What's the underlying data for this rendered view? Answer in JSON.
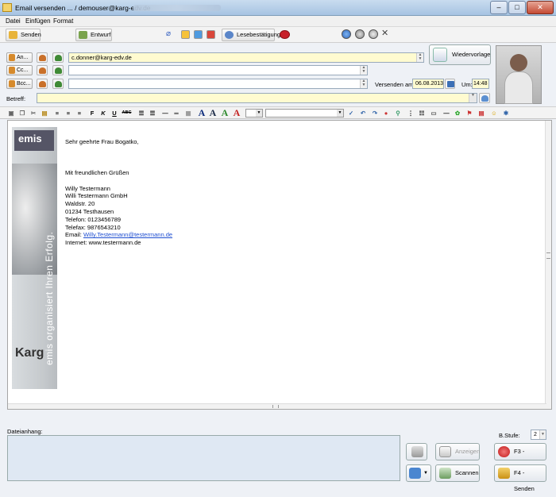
{
  "window": {
    "title": "Email versenden ... / demouser@karg-edv.de",
    "min": "–",
    "max": "□",
    "close": "✕"
  },
  "menu": [
    "Datei",
    "Einfügen",
    "Format"
  ],
  "toolbar": {
    "send": "Senden",
    "draft": "Entwurf",
    "read_receipt": "Lesebestätigung"
  },
  "header": {
    "to_label": "An...",
    "cc_label": "Cc...",
    "bcc_label": "Bcc...",
    "to_value": "c.donner@karg-edv.de",
    "cc_value": "",
    "bcc_value": "",
    "reminder_label": "Wiedervorlage",
    "send_on_label": "Versenden am:",
    "send_date": "06.08.2013",
    "time_label": "Um:",
    "send_time": "14:48",
    "subject_label": "Betreff:",
    "subject_value": ""
  },
  "format": {
    "bold": "F",
    "italic": "K",
    "underline": "U",
    "strike": "ABC"
  },
  "body": {
    "salutation": "Sehr geehrte Frau Bogatko,",
    "closing": "Mit freundlichen Grüßen",
    "sig": [
      "Willy Testermann",
      "Willi Testermann GmbH",
      "Waldstr. 20",
      "01234 Testhausen",
      "Telefon: 0123456789",
      "Telefax: 9876543210"
    ],
    "email_label": "Email:",
    "email": "Willy.Testermann@testermann.de",
    "internet": "Internet: www.testermann.de"
  },
  "banner": {
    "logo": "emis",
    "slogan": "emis organisiert Ihren Erfolg.",
    "brand": "Karg"
  },
  "footer": {
    "attach_label": "Dateianhang:",
    "level_label": "B.Stufe:",
    "level_value": "2",
    "show": "Anzeigen",
    "scan": "Scannen",
    "cancel": "F3 - Abbruch",
    "send": "F4 - Senden"
  },
  "colors": {
    "accent": "#1f4fd1",
    "field_yellow": "#fffbd0"
  }
}
